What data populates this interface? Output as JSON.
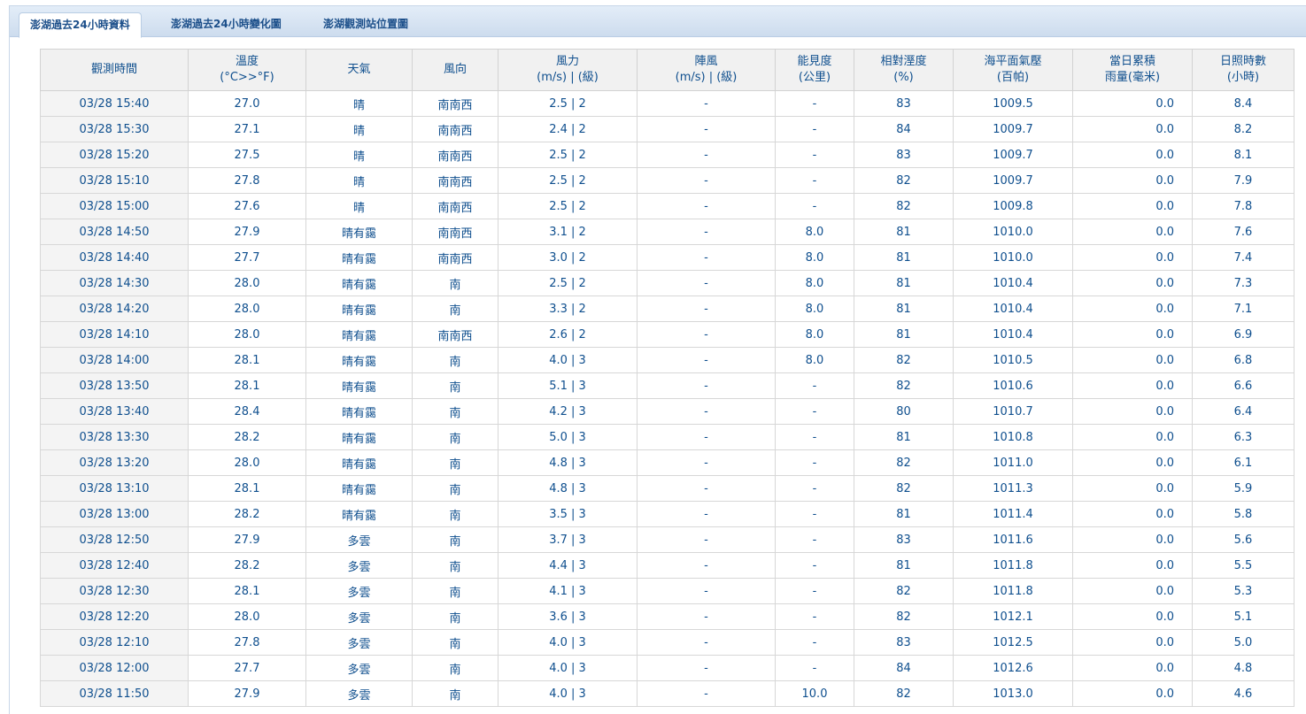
{
  "tabs": [
    {
      "label": "澎湖過去24小時資料",
      "active": true
    },
    {
      "label": "澎湖過去24小時變化圖",
      "active": false
    },
    {
      "label": "澎湖觀測站位置圖",
      "active": false
    }
  ],
  "columns": [
    {
      "line1": "觀測時間",
      "line2": ""
    },
    {
      "line1": "溫度",
      "line2": "(°C>>°F)"
    },
    {
      "line1": "天氣",
      "line2": ""
    },
    {
      "line1": "風向",
      "line2": ""
    },
    {
      "line1": "風力",
      "line2": "(m/s) | (級)"
    },
    {
      "line1": "陣風",
      "line2": "(m/s) | (級)"
    },
    {
      "line1": "能見度",
      "line2": "(公里)"
    },
    {
      "line1": "相對溼度",
      "line2": "(%)"
    },
    {
      "line1": "海平面氣壓",
      "line2": "(百帕)"
    },
    {
      "line1": "當日累積",
      "line2": "雨量(毫米)"
    },
    {
      "line1": "日照時數",
      "line2": "(小時)"
    }
  ],
  "rows": [
    [
      "03/28 15:40",
      "27.0",
      "晴",
      "南南西",
      "2.5 | 2",
      "-",
      "-",
      "83",
      "1009.5",
      "0.0",
      "8.4"
    ],
    [
      "03/28 15:30",
      "27.1",
      "晴",
      "南南西",
      "2.4 | 2",
      "-",
      "-",
      "84",
      "1009.7",
      "0.0",
      "8.2"
    ],
    [
      "03/28 15:20",
      "27.5",
      "晴",
      "南南西",
      "2.5 | 2",
      "-",
      "-",
      "83",
      "1009.7",
      "0.0",
      "8.1"
    ],
    [
      "03/28 15:10",
      "27.8",
      "晴",
      "南南西",
      "2.5 | 2",
      "-",
      "-",
      "82",
      "1009.7",
      "0.0",
      "7.9"
    ],
    [
      "03/28 15:00",
      "27.6",
      "晴",
      "南南西",
      "2.5 | 2",
      "-",
      "-",
      "82",
      "1009.8",
      "0.0",
      "7.8"
    ],
    [
      "03/28 14:50",
      "27.9",
      "晴有靄",
      "南南西",
      "3.1 | 2",
      "-",
      "8.0",
      "81",
      "1010.0",
      "0.0",
      "7.6"
    ],
    [
      "03/28 14:40",
      "27.7",
      "晴有靄",
      "南南西",
      "3.0 | 2",
      "-",
      "8.0",
      "81",
      "1010.0",
      "0.0",
      "7.4"
    ],
    [
      "03/28 14:30",
      "28.0",
      "晴有靄",
      "南",
      "2.5 | 2",
      "-",
      "8.0",
      "81",
      "1010.4",
      "0.0",
      "7.3"
    ],
    [
      "03/28 14:20",
      "28.0",
      "晴有靄",
      "南",
      "3.3 | 2",
      "-",
      "8.0",
      "81",
      "1010.4",
      "0.0",
      "7.1"
    ],
    [
      "03/28 14:10",
      "28.0",
      "晴有靄",
      "南南西",
      "2.6 | 2",
      "-",
      "8.0",
      "81",
      "1010.4",
      "0.0",
      "6.9"
    ],
    [
      "03/28 14:00",
      "28.1",
      "晴有靄",
      "南",
      "4.0 | 3",
      "-",
      "8.0",
      "82",
      "1010.5",
      "0.0",
      "6.8"
    ],
    [
      "03/28 13:50",
      "28.1",
      "晴有靄",
      "南",
      "5.1 | 3",
      "-",
      "-",
      "82",
      "1010.6",
      "0.0",
      "6.6"
    ],
    [
      "03/28 13:40",
      "28.4",
      "晴有靄",
      "南",
      "4.2 | 3",
      "-",
      "-",
      "80",
      "1010.7",
      "0.0",
      "6.4"
    ],
    [
      "03/28 13:30",
      "28.2",
      "晴有靄",
      "南",
      "5.0 | 3",
      "-",
      "-",
      "81",
      "1010.8",
      "0.0",
      "6.3"
    ],
    [
      "03/28 13:20",
      "28.0",
      "晴有靄",
      "南",
      "4.8 | 3",
      "-",
      "-",
      "82",
      "1011.0",
      "0.0",
      "6.1"
    ],
    [
      "03/28 13:10",
      "28.1",
      "晴有靄",
      "南",
      "4.8 | 3",
      "-",
      "-",
      "82",
      "1011.3",
      "0.0",
      "5.9"
    ],
    [
      "03/28 13:00",
      "28.2",
      "晴有靄",
      "南",
      "3.5 | 3",
      "-",
      "-",
      "81",
      "1011.4",
      "0.0",
      "5.8"
    ],
    [
      "03/28 12:50",
      "27.9",
      "多雲",
      "南",
      "3.7 | 3",
      "-",
      "-",
      "83",
      "1011.6",
      "0.0",
      "5.6"
    ],
    [
      "03/28 12:40",
      "28.2",
      "多雲",
      "南",
      "4.4 | 3",
      "-",
      "-",
      "81",
      "1011.8",
      "0.0",
      "5.5"
    ],
    [
      "03/28 12:30",
      "28.1",
      "多雲",
      "南",
      "4.1 | 3",
      "-",
      "-",
      "82",
      "1011.8",
      "0.0",
      "5.3"
    ],
    [
      "03/28 12:20",
      "28.0",
      "多雲",
      "南",
      "3.6 | 3",
      "-",
      "-",
      "82",
      "1012.1",
      "0.0",
      "5.1"
    ],
    [
      "03/28 12:10",
      "27.8",
      "多雲",
      "南",
      "4.0 | 3",
      "-",
      "-",
      "83",
      "1012.5",
      "0.0",
      "5.0"
    ],
    [
      "03/28 12:00",
      "27.7",
      "多雲",
      "南",
      "4.0 | 3",
      "-",
      "-",
      "84",
      "1012.6",
      "0.0",
      "4.8"
    ],
    [
      "03/28 11:50",
      "27.9",
      "多雲",
      "南",
      "4.0 | 3",
      "-",
      "10.0",
      "82",
      "1013.0",
      "0.0",
      "4.6"
    ]
  ]
}
